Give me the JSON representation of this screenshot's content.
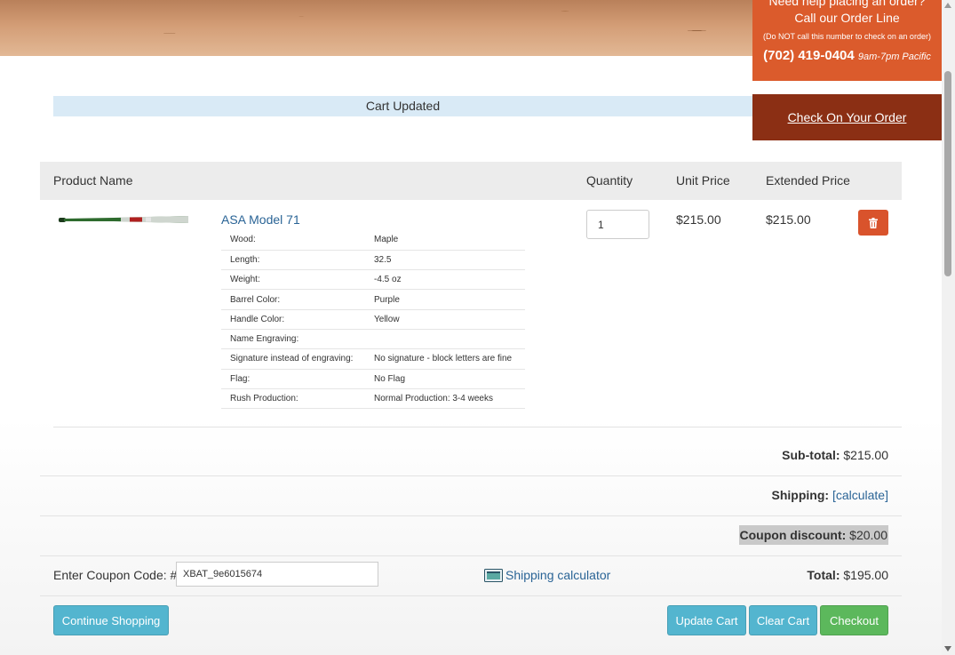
{
  "header": {
    "help_line1": "Need help placing an order?",
    "help_line2": "Call our Order Line",
    "help_line3": "(Do NOT call this number to check on an order)",
    "phone": "(702) 419-0404",
    "hours": "9am-7pm Pacific",
    "check_order": "Check On Your Order"
  },
  "alert": {
    "text": "Cart Updated"
  },
  "table": {
    "headers": {
      "product_name": "Product Name",
      "quantity": "Quantity",
      "unit_price": "Unit Price",
      "extended_price": "Extended Price"
    },
    "item": {
      "name": "ASA Model 71",
      "quantity": "1",
      "unit_price": "$215.00",
      "extended_price": "$215.00",
      "options": [
        {
          "label": "Wood:",
          "value": "Maple"
        },
        {
          "label": "Length:",
          "value": "32.5"
        },
        {
          "label": "Weight:",
          "value": "-4.5 oz"
        },
        {
          "label": "Barrel Color:",
          "value": "Purple"
        },
        {
          "label": "Handle Color:",
          "value": "Yellow"
        },
        {
          "label": "Name Engraving:",
          "value": ""
        },
        {
          "label": "Signature instead of engraving:",
          "value": "No signature - block letters are fine"
        },
        {
          "label": "Flag:",
          "value": "No Flag"
        },
        {
          "label": "Rush Production:",
          "value": "Normal Production: 3-4 weeks"
        }
      ]
    }
  },
  "summary": {
    "subtotal_label": "Sub-total:",
    "subtotal_value": "$215.00",
    "shipping_label": "Shipping:",
    "shipping_link": "[calculate]",
    "coupon_label": "Coupon discount:",
    "coupon_value": "$20.00",
    "total_label": "Total:",
    "total_value": "$195.00"
  },
  "coupon": {
    "label": "Enter Coupon Code: #",
    "value": "XBAT_9e6015674"
  },
  "shipping_calculator": "Shipping calculator",
  "buttons": {
    "continue": "Continue Shopping",
    "update": "Update Cart",
    "clear": "Clear Cart",
    "checkout": "Checkout"
  },
  "colors": {
    "orange": "#db5b2c",
    "dark_red": "#8b2f14",
    "info": "#53b5cf",
    "success": "#5cb85c",
    "link": "#2a6496"
  },
  "icons": [
    "trash-icon",
    "calculator-icon",
    "bat-image"
  ]
}
